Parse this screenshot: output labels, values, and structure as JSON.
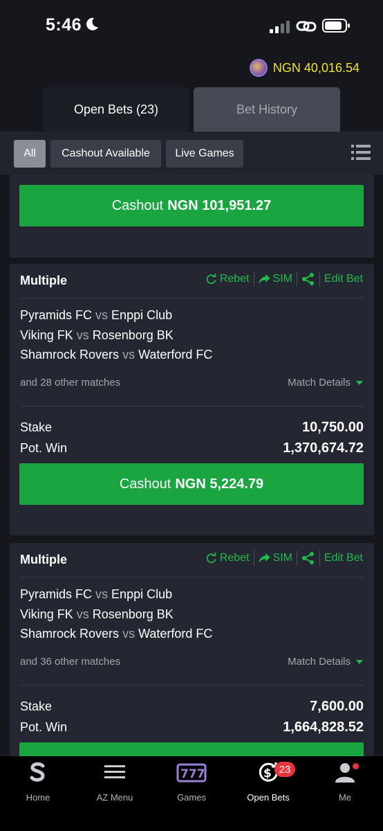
{
  "status_bar": {
    "time": "5:46"
  },
  "balance": {
    "text": "NGN 40,016.54"
  },
  "tabs": [
    {
      "label": "Open Bets (23)",
      "active": true
    },
    {
      "label": "Bet History",
      "active": false
    }
  ],
  "filters": [
    {
      "label": "All",
      "active": true
    },
    {
      "label": "Cashout Available",
      "active": false
    },
    {
      "label": "Live Games",
      "active": false
    }
  ],
  "top_card": {
    "cashout_prefix": "Cashout",
    "cashout_amount": "NGN 101,951.27"
  },
  "bets": [
    {
      "title": "Multiple",
      "actions": {
        "rebet": "Rebet",
        "sim": "SIM",
        "edit": "Edit Bet"
      },
      "matches": [
        {
          "home": "Pyramids FC",
          "vs": "vs",
          "away": "Enppi Club"
        },
        {
          "home": "Viking FK",
          "vs": "vs",
          "away": "Rosenborg BK"
        },
        {
          "home": "Shamrock Rovers",
          "vs": "vs",
          "away": "Waterford FC"
        }
      ],
      "more_matches": "and 28 other matches",
      "match_details": "Match Details",
      "stake_label": "Stake",
      "stake_value": "10,750.00",
      "potwin_label": "Pot. Win",
      "potwin_value": "1,370,674.72",
      "cashout_prefix": "Cashout",
      "cashout_amount": "NGN 5,224.79"
    },
    {
      "title": "Multiple",
      "actions": {
        "rebet": "Rebet",
        "sim": "SIM",
        "edit": "Edit Bet"
      },
      "matches": [
        {
          "home": "Pyramids FC",
          "vs": "vs",
          "away": "Enppi Club"
        },
        {
          "home": "Viking FK",
          "vs": "vs",
          "away": "Rosenborg BK"
        },
        {
          "home": "Shamrock Rovers",
          "vs": "vs",
          "away": "Waterford FC"
        }
      ],
      "more_matches": "and 36 other matches",
      "match_details": "Match Details",
      "stake_label": "Stake",
      "stake_value": "7,600.00",
      "potwin_label": "Pot. Win",
      "potwin_value": "1,664,828.52"
    }
  ],
  "bottom_nav": [
    {
      "label": "Home",
      "icon": "sporty-s-icon"
    },
    {
      "label": "AZ Menu",
      "icon": "hamburger-menu-icon"
    },
    {
      "label": "Games",
      "icon": "slot-777-icon"
    },
    {
      "label": "Open Bets",
      "icon": "open-bets-icon",
      "badge": "23",
      "active": true
    },
    {
      "label": "Me",
      "icon": "user-icon"
    }
  ],
  "colors": {
    "accent_green": "#1aa541",
    "balance_yellow": "#f2e32a",
    "badge_red": "#e8353d"
  }
}
